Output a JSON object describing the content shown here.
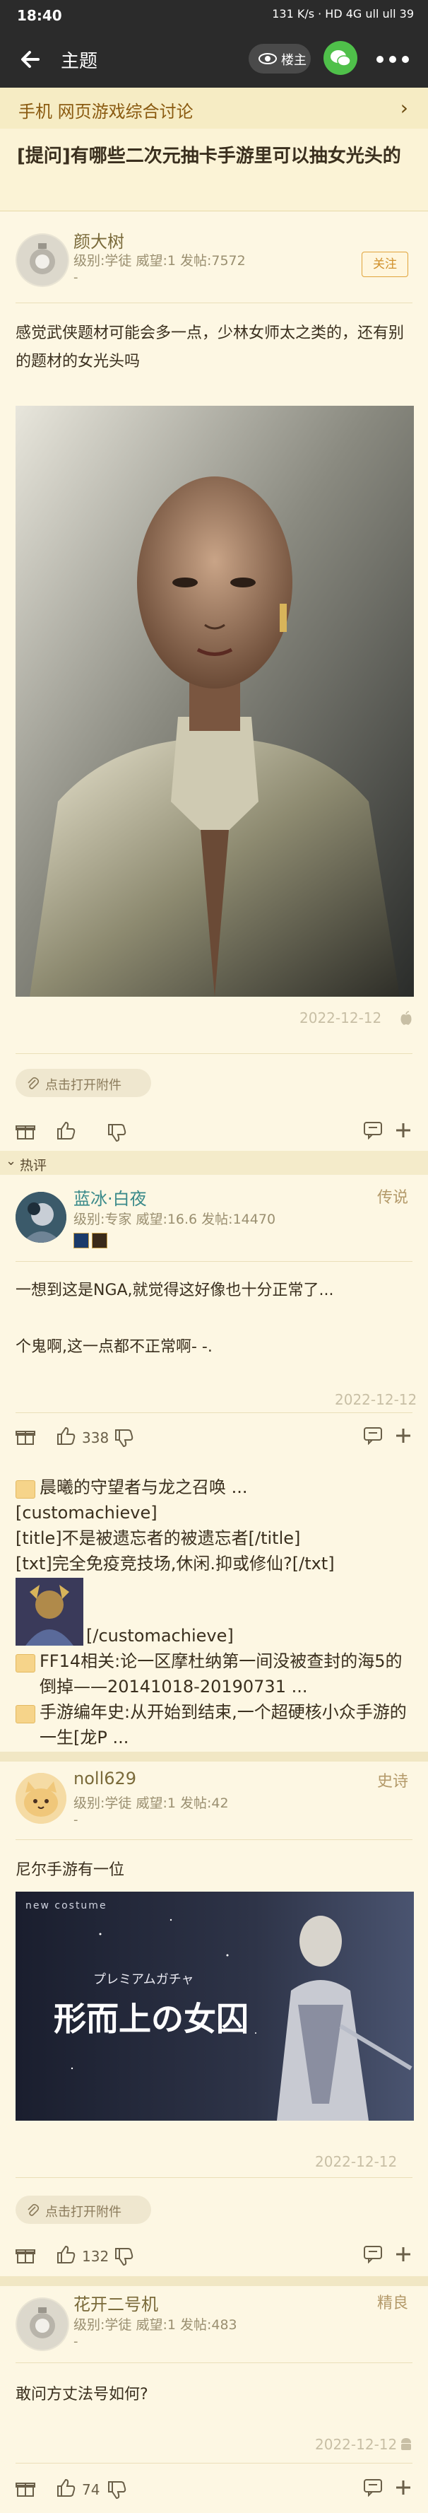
{
  "status": {
    "time": "18:40",
    "right": "131 K/s · HD 4G ull ull 39"
  },
  "header": {
    "title": "主题",
    "op_label": "楼主"
  },
  "forum": {
    "breadcrumb": "手机 网页游戏综合讨论"
  },
  "thread": {
    "title": "[提问]有哪些二次元抽卡手游里可以抽女光头的"
  },
  "op": {
    "name": "颜大树",
    "meta": "级别:学徒 威望:1 发帖:7572",
    "dash": "-",
    "follow": "关注",
    "text": "感觉武侠题材可能会多一点，少林女师太之类的，还有别的题材的女光头吗",
    "date": "2022-12-12",
    "attach": "点击打开附件"
  },
  "hot_label": "热评",
  "reply1": {
    "name": "蓝冰·白夜",
    "tag": "传说",
    "meta": "级别:专家 威望:16.6 发帖:14470",
    "line1": "一想到这是NGA,就觉得这好像也十分正常了...",
    "line2": "个鬼啊,这一点都不正常啊- -.",
    "date": "2022-12-12",
    "likes": "338"
  },
  "signature": {
    "line1": "晨曦的守望者与龙之召唤 ...",
    "line2": "[customachieve]",
    "line3": "[title]不是被遗忘者的被遗忘者[/title]",
    "line4": "[txt]完全免疫竞技场,休闲.抑或修仙?[/txt]",
    "line5": "[/customachieve]",
    "line6": "FF14相关:论一区摩杜纳第一间没被查封的海5的倒掉——20141018-20190731 ...",
    "line7": "手游编年史:从开始到结束,一个超硬核小众手游的一生[龙P ..."
  },
  "reply2": {
    "name": "noll629",
    "tag": "史诗",
    "meta": "级别:学徒 威望:1 发帖:42",
    "dash": "-",
    "text": "尼尔手游有一位",
    "banner_top": "new costume",
    "banner_sub": "プレミアムガチャ",
    "banner_title": "形而上の女囚",
    "date": "2022-12-12",
    "attach": "点击打开附件",
    "likes": "132"
  },
  "reply3": {
    "name": "花开二号机",
    "tag": "精良",
    "meta": "级别:学徒 威望:1 发帖:483",
    "dash": "-",
    "text": "敢问方丈法号如何?",
    "date": "2022-12-12",
    "likes": "74"
  }
}
